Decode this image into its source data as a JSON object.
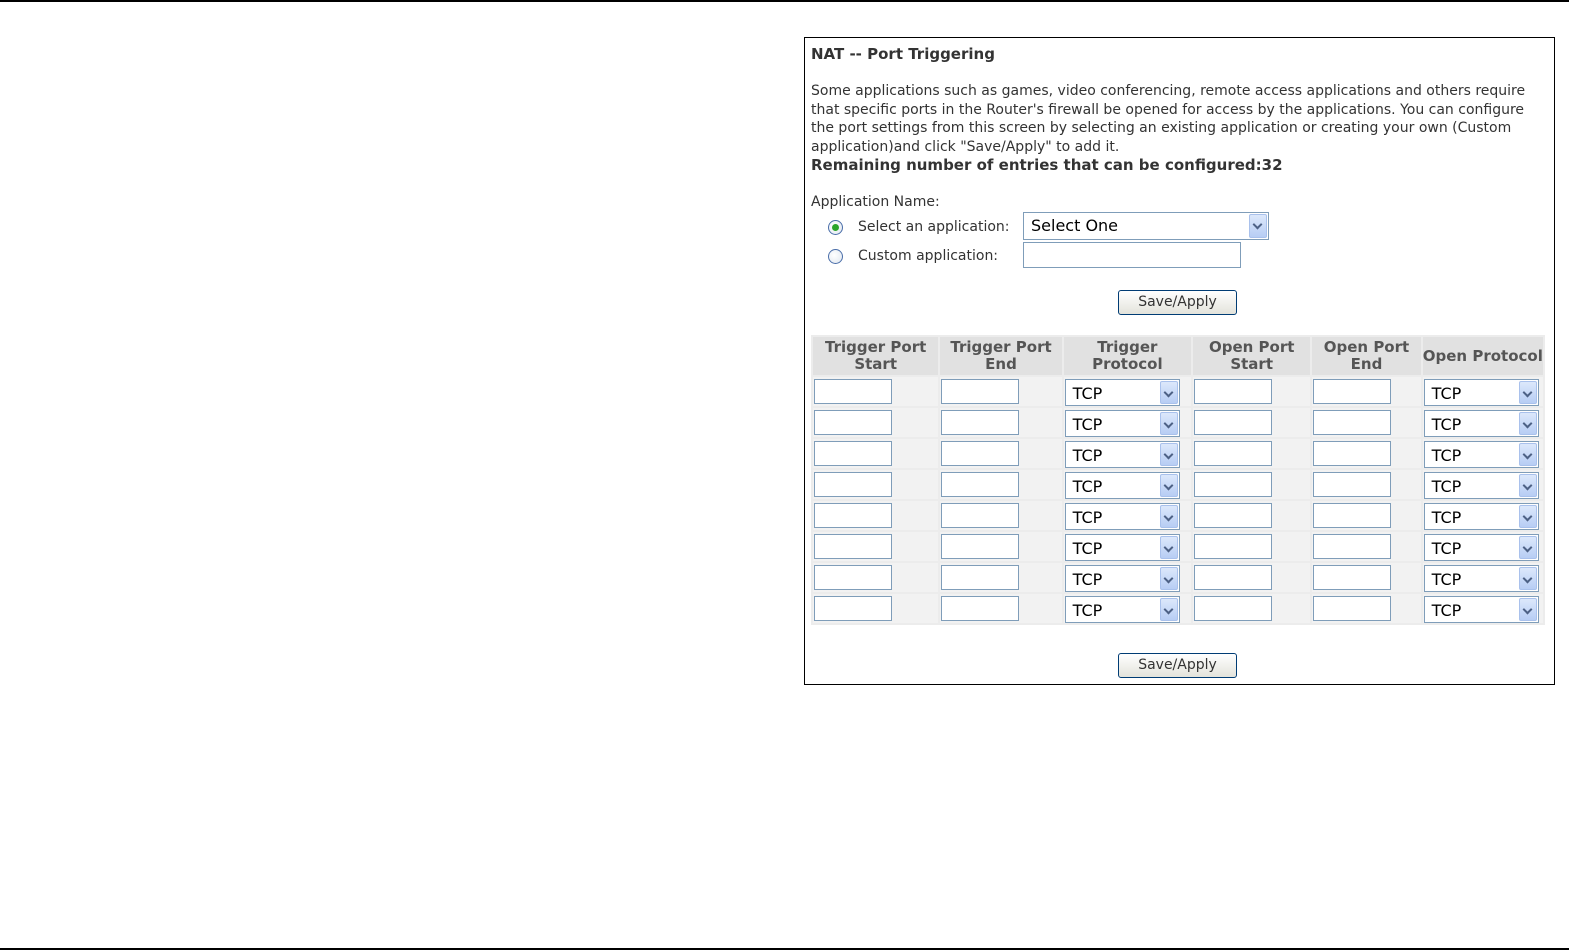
{
  "page": {
    "title": "NAT -- Port Triggering",
    "description": "Some applications such as games, video conferencing, remote access applications and others require that specific ports in the Router's firewall be opened for access by the applications. You can configure the port settings from this screen by selecting an existing application or creating your own (Custom application)and click \"Save/Apply\" to add it.",
    "remaining": "Remaining number of entries that can be configured:32"
  },
  "app": {
    "name_label": "Application Name:",
    "select_label": "Select an application:",
    "select_value": "Select One",
    "custom_label": "Custom application:",
    "custom_value": ""
  },
  "buttons": {
    "save_apply": "Save/Apply"
  },
  "table": {
    "headers": [
      "Trigger Port Start",
      "Trigger Port End",
      "Trigger Protocol",
      "Open Port Start",
      "Open Port End",
      "Open Protocol"
    ],
    "rows": [
      {
        "trigger_start": "",
        "trigger_end": "",
        "trigger_protocol": "TCP",
        "open_start": "",
        "open_end": "",
        "open_protocol": "TCP"
      },
      {
        "trigger_start": "",
        "trigger_end": "",
        "trigger_protocol": "TCP",
        "open_start": "",
        "open_end": "",
        "open_protocol": "TCP"
      },
      {
        "trigger_start": "",
        "trigger_end": "",
        "trigger_protocol": "TCP",
        "open_start": "",
        "open_end": "",
        "open_protocol": "TCP"
      },
      {
        "trigger_start": "",
        "trigger_end": "",
        "trigger_protocol": "TCP",
        "open_start": "",
        "open_end": "",
        "open_protocol": "TCP"
      },
      {
        "trigger_start": "",
        "trigger_end": "",
        "trigger_protocol": "TCP",
        "open_start": "",
        "open_end": "",
        "open_protocol": "TCP"
      },
      {
        "trigger_start": "",
        "trigger_end": "",
        "trigger_protocol": "TCP",
        "open_start": "",
        "open_end": "",
        "open_protocol": "TCP"
      },
      {
        "trigger_start": "",
        "trigger_end": "",
        "trigger_protocol": "TCP",
        "open_start": "",
        "open_end": "",
        "open_protocol": "TCP"
      },
      {
        "trigger_start": "",
        "trigger_end": "",
        "trigger_protocol": "TCP",
        "open_start": "",
        "open_end": "",
        "open_protocol": "TCP"
      }
    ]
  }
}
